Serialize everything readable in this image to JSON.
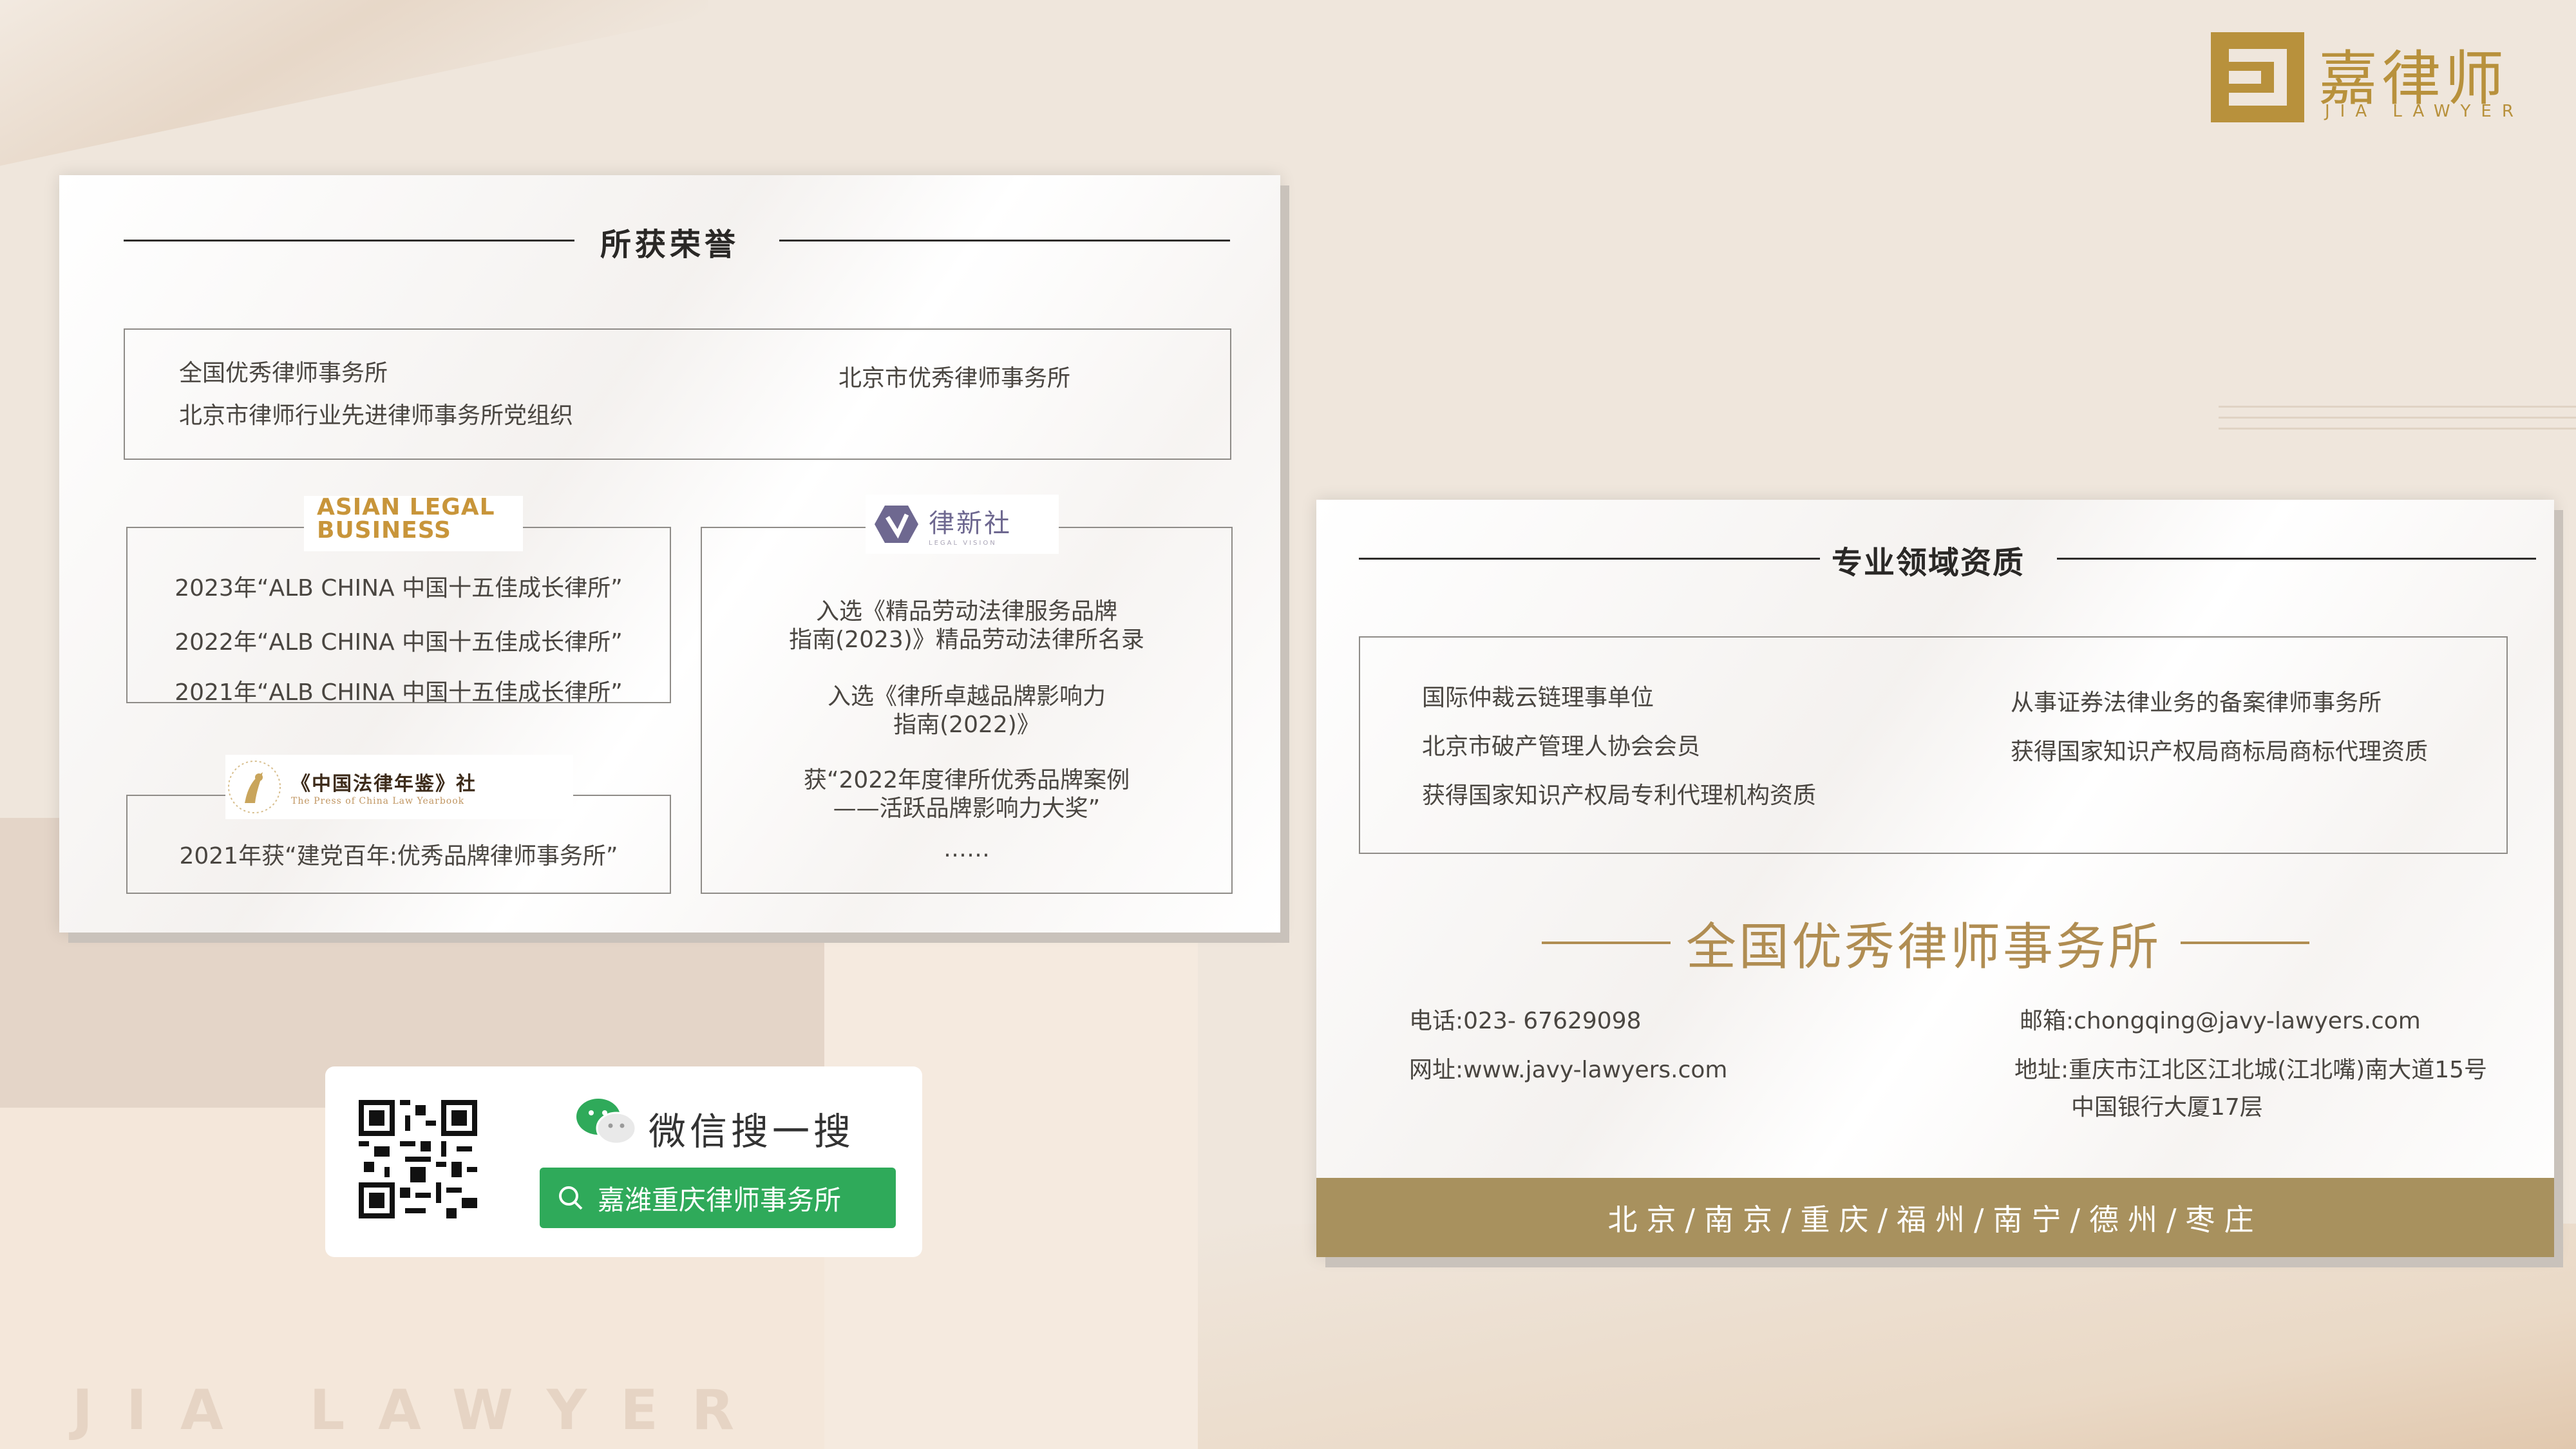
{
  "brand": {
    "name_cn": "嘉律师",
    "name_en": "JIA LAWYER"
  },
  "watermark": "JIA LAWYER",
  "honors": {
    "title": "所获荣誉",
    "top_box": {
      "left_lines": [
        "全国优秀律师事务所",
        "北京市律师行业先进律师事务所党组织"
      ],
      "right_line": "北京市优秀律师事务所"
    },
    "alb": {
      "logo_line1": "ASIAN LEGAL",
      "logo_line2": "BUSINESS",
      "items": [
        "2023年“ALB CHINA 中国十五佳成长律所”",
        "2022年“ALB CHINA 中国十五佳成长律所”",
        "2021年“ALB CHINA 中国十五佳成长律所”"
      ]
    },
    "yearbook": {
      "logo_text": "《中国法律年鉴》社",
      "logo_sub": "The Press of China Law Yearbook",
      "item": "2021年获“建党百年:优秀品牌律师事务所”"
    },
    "lxs": {
      "logo_text": "律新社",
      "logo_sub": "LEGAL VISION",
      "items": [
        "入选《精品劳动法律服务品牌",
        "指南(2023)》精品劳动法律所名录",
        "入选《律所卓越品牌影响力",
        "指南(2022)》",
        "获“2022年度律所优秀品牌案例",
        "——活跃品牌影响力大奖”",
        "……"
      ]
    }
  },
  "wechat": {
    "title": "微信搜一搜",
    "search_text": "嘉潍重庆律师事务所"
  },
  "qualifications": {
    "title": "专业领域资质",
    "left_items": [
      "国际仲裁云链理事单位",
      "北京市破产管理人协会会员",
      "获得国家知识产权局专利代理机构资质"
    ],
    "right_items": [
      "从事证券法律业务的备案律师事务所",
      "获得国家知识产权局商标局商标代理资质"
    ]
  },
  "firm": {
    "title": "全国优秀律师事务所",
    "phone": "电话:023- 67629098",
    "website": "网址:www.javy-lawyers.com",
    "email": "邮箱:chongqing@javy-lawyers.com",
    "address_line1": "地址:重庆市江北区江北城(江北嘴)南大道15号",
    "address_line2": "中国银行大厦17层",
    "cities": "北京/南京/重庆/福州/南宁/德州/枣庄"
  },
  "colors": {
    "gold": "#b08d52",
    "bar": "#a8915e",
    "wechat_green": "#2faa5a"
  }
}
